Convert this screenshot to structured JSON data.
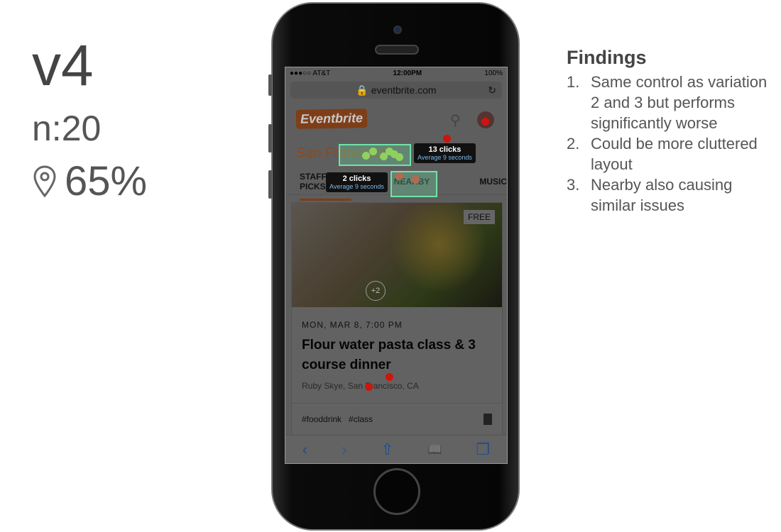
{
  "summary": {
    "version": "v4",
    "sample": "n:20",
    "success_rate": "65%",
    "pin_icon": "map-pin-icon"
  },
  "findings": {
    "title": "Findings",
    "items": [
      {
        "num": "1.",
        "text": "Same control as variation 2 and 3 but performs significantly worse"
      },
      {
        "num": "2.",
        "text": "Could be more cluttered layout"
      },
      {
        "num": "3.",
        "text": "Nearby also causing similar issues"
      }
    ]
  },
  "phone": {
    "status": {
      "carrier": "●●●○○ AT&T",
      "time": "12:00PM",
      "battery": "100%"
    },
    "url": "eventbrite.com",
    "logo": "Eventbrite",
    "city": "San Francisco",
    "tabs": [
      "STAFF PICKS",
      "NEARBY",
      "MUSIC"
    ],
    "card": {
      "badge": "FREE",
      "date": "MON, MAR 8, 7:00 PM",
      "title": "Flour water pasta class & 3 course dinner",
      "location": "Ruby Skye, San Francisco, CA",
      "tags": "#fooddrink   #class",
      "extra": "+2"
    },
    "toolbar": [
      "‹",
      "›",
      "⇧",
      "📖",
      "❐"
    ]
  },
  "heatmap": {
    "colors": {
      "success": "#6fe3a8",
      "miss": "#d0140c"
    },
    "tooltips": [
      {
        "clicks": "13 clicks",
        "avg": "Average 9 seconds"
      },
      {
        "clicks": "2 clicks",
        "avg": "Average 9 seconds"
      }
    ]
  }
}
